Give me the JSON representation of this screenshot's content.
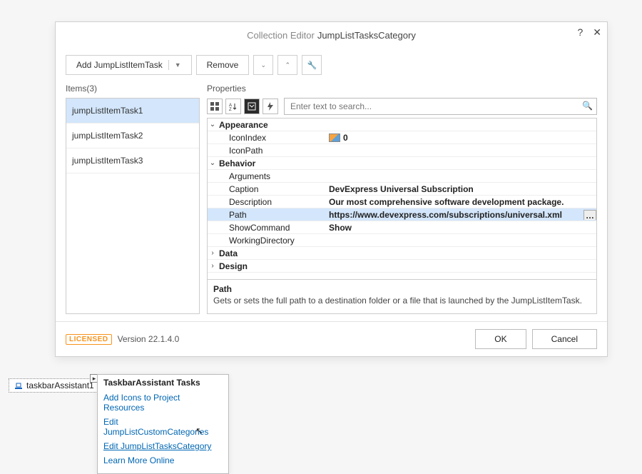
{
  "dialog": {
    "title_prefix": "Collection Editor",
    "title_name": "JumpListTasksCategory",
    "add_button": "Add JumpListItemTask",
    "remove_button": "Remove",
    "items_label": "Items(3)",
    "properties_label": "Properties",
    "search_placeholder": "Enter text to search...",
    "items": [
      {
        "label": "jumpListItemTask1",
        "selected": true
      },
      {
        "label": "jumpListItemTask2",
        "selected": false
      },
      {
        "label": "jumpListItemTask3",
        "selected": false
      }
    ],
    "groups": [
      {
        "name": "Appearance",
        "expanded": true,
        "rows": [
          {
            "name": "IconIndex",
            "value": "0",
            "icon": true,
            "bold": true
          },
          {
            "name": "IconPath",
            "value": ""
          }
        ]
      },
      {
        "name": "Behavior",
        "expanded": true,
        "rows": [
          {
            "name": "Arguments",
            "value": ""
          },
          {
            "name": "Caption",
            "value": "DevExpress Universal Subscription",
            "bold": true
          },
          {
            "name": "Description",
            "value": "Our most comprehensive software development package.",
            "bold": true
          },
          {
            "name": "Path",
            "value": "https://www.devexpress.com/subscriptions/universal.xml",
            "bold": true,
            "selected": true,
            "ellipsis": true
          },
          {
            "name": "ShowCommand",
            "value": "Show",
            "bold": true
          },
          {
            "name": "WorkingDirectory",
            "value": ""
          }
        ]
      },
      {
        "name": "Data",
        "expanded": false,
        "rows": []
      },
      {
        "name": "Design",
        "expanded": false,
        "rows": []
      }
    ],
    "desc_name": "Path",
    "desc_text": "Gets or sets the full path to a destination folder or a file that is launched by the JumpListItemTask.",
    "licensed_label": "LICENSED",
    "version": "Version 22.1.4.0",
    "ok": "OK",
    "cancel": "Cancel"
  },
  "tray": {
    "component": "taskbarAssistant1"
  },
  "smart": {
    "title": "TaskbarAssistant Tasks",
    "links": [
      {
        "text": "Add Icons to Project Resources",
        "active": false
      },
      {
        "text": "Edit JumpListCustomCategories",
        "active": false
      },
      {
        "text": "Edit JumpListTasksCategory",
        "active": true
      },
      {
        "text": "Learn More Online",
        "active": false
      }
    ]
  }
}
